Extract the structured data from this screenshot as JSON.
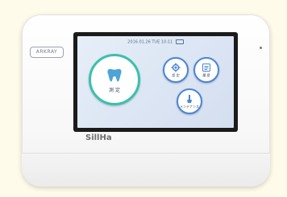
{
  "device": {
    "brand": "ARKRAY",
    "product": "SillHa"
  },
  "screen": {
    "date": "2016.01.26",
    "day": "TUE",
    "time": "10:11",
    "buttons": {
      "measure": "測 定",
      "settings": "設 定",
      "history": "履 歴",
      "maintenance": "メンテナンス"
    }
  },
  "colors": {
    "accent_green": "#39c1ac",
    "accent_blue": "#4a86d6"
  }
}
